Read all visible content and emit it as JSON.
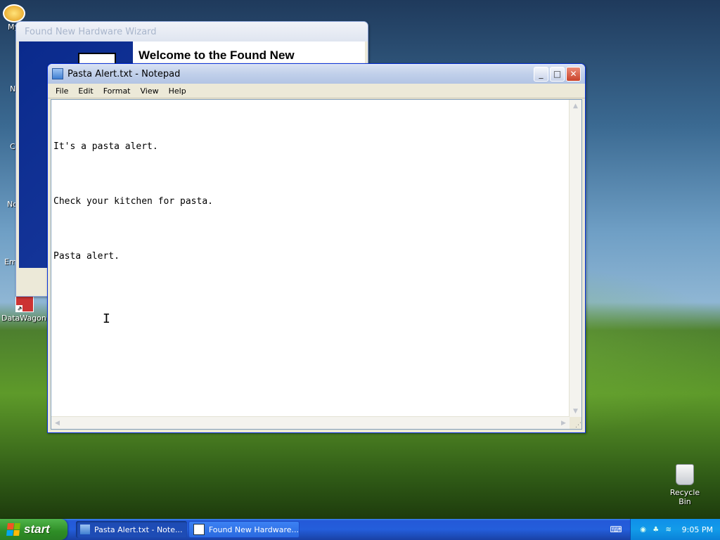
{
  "desktop": {
    "icons": [
      {
        "label": "My",
        "icon": "my-computer-icon"
      },
      {
        "label": "N",
        "icon": "network-icon"
      },
      {
        "label": "C",
        "icon": "computer-icon"
      },
      {
        "label": "No",
        "icon": "notepad-icon"
      },
      {
        "label": "Em",
        "icon": "email-icon"
      },
      {
        "label": "DataWagon.",
        "icon": "shortcut-icon"
      },
      {
        "label": "Recycle Bin",
        "icon": "recycle-bin-icon"
      }
    ]
  },
  "wizard": {
    "title": "Found New Hardware Wizard",
    "heading": "Welcome to the Found New"
  },
  "notepad": {
    "title": "Pasta Alert.txt - Notepad",
    "menu": [
      "File",
      "Edit",
      "Format",
      "View",
      "Help"
    ],
    "lines": [
      "It's a pasta alert.",
      "Check your kitchen for pasta.",
      "Pasta alert."
    ]
  },
  "taskbar": {
    "start_label": "start",
    "buttons": [
      {
        "label": "Pasta Alert.txt - Note...",
        "icon": "notepad-icon"
      },
      {
        "label": "Found New Hardware...",
        "icon": "wizard-icon"
      }
    ],
    "clock": "9:05 PM"
  }
}
